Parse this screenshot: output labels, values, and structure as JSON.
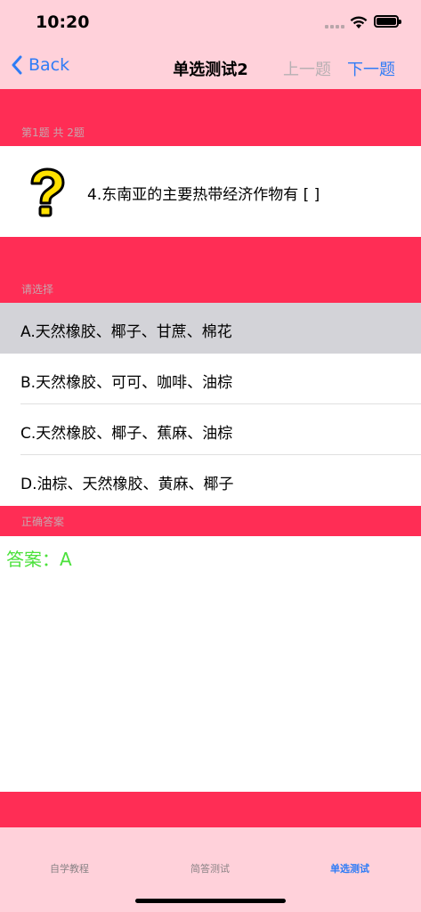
{
  "status_bar": {
    "time": "10:20"
  },
  "nav": {
    "back_label": "Back",
    "title": "单选测试2",
    "prev_label": "上一题",
    "next_label": "下一题"
  },
  "question_header": "第1题 共 2题",
  "question": {
    "text": "4.东南亚的主要热带经济作物有 [ ]",
    "icon": "question-mark-icon"
  },
  "options_header": "请选择",
  "options": [
    {
      "label": "A.天然橡胶、椰子、甘蔗、棉花",
      "selected": true
    },
    {
      "label": "B.天然橡胶、可可、咖啡、油棕",
      "selected": false
    },
    {
      "label": "C.天然橡胶、椰子、蕉麻、油棕",
      "selected": false
    },
    {
      "label": "D.油棕、天然橡胶、黄麻、椰子",
      "selected": false
    }
  ],
  "answer_header": "正确答案",
  "answer": "答案：A",
  "tabs": [
    {
      "label": "自学教程",
      "active": false
    },
    {
      "label": "简答测试",
      "active": false
    },
    {
      "label": "单选测试",
      "active": true
    }
  ],
  "colors": {
    "bar_background": "#ffd1da",
    "accent_red": "#ff2d55",
    "link_blue": "#2f7cf6",
    "answer_green": "#4be13b",
    "selected_row": "#d3d3d8"
  }
}
